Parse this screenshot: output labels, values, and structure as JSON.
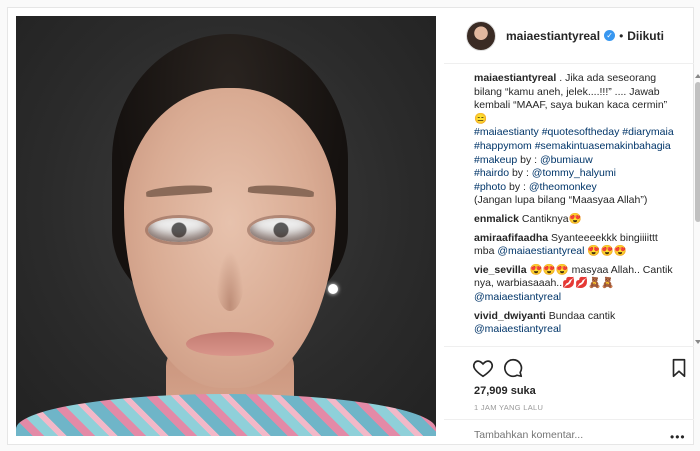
{
  "header": {
    "username": "maiaestiantyreal",
    "separator": "•",
    "follow_label": "Diikuti",
    "verified_icon": "verified-badge-icon"
  },
  "caption": {
    "username": "maiaestiantyreal",
    "line1": " . Jika ada seseorang bilang “kamu aneh, jelek....!!!” .... Jawab kembali “MAAF, saya bukan kaca cermin” 😑",
    "tag1": "#maiaestianty",
    "tag2": "#quotesoftheday",
    "tag3": "#diarymaia",
    "tag4": "#happymom",
    "tag5": "#semakintuasemakinbahagia",
    "tag6": "#makeup",
    "by1": " by : ",
    "mention1": "@bumiauw",
    "tag7": "#hairdo",
    "by2": " by : ",
    "mention2": "@tommy_halyumi",
    "tag8": "#photo",
    "by3": " by : ",
    "mention3": "@theomonkey",
    "closing": "(Jangan lupa bilang “Maasyaa Allah”)"
  },
  "comments": [
    {
      "user": "enmalick",
      "text": " Cantiknya😍"
    },
    {
      "user": "amiraafifaadha",
      "text": " Syanteeeekkk bingiiiittt mba ",
      "mention": "@maiaestiantyreal",
      "tail": " 😍😍😍"
    },
    {
      "user": "vie_sevilla",
      "text": " 😍😍😍 masyaa Allah.. Cantik nya, warbiasaaah..💋💋🧸🧸",
      "mention": "@maiaestiantyreal"
    },
    {
      "user": "vivid_dwiyanti",
      "text": " Bundaa cantik",
      "mention": "@maiaestiantyreal"
    }
  ],
  "actions": {
    "like_icon": "heart-icon",
    "comment_icon": "comment-icon",
    "save_icon": "bookmark-icon",
    "likes": "27,909 suka",
    "time": "1 JAM YANG LALU",
    "add_comment_placeholder": "Tambahkan komentar...",
    "more": "•••"
  }
}
